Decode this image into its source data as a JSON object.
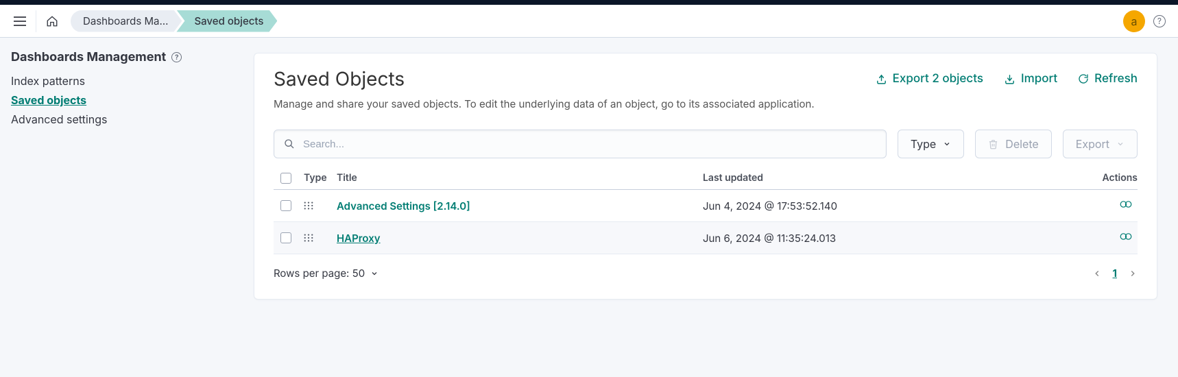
{
  "app_title": "Dashboards Management",
  "breadcrumbs": [
    {
      "label": "Dashboards Ma…"
    },
    {
      "label": "Saved objects",
      "active": true
    }
  ],
  "avatar_letter": "a",
  "sidebar": {
    "title": "Dashboards Management",
    "items": [
      {
        "label": "Index patterns"
      },
      {
        "label": "Saved objects",
        "active": true
      },
      {
        "label": "Advanced settings"
      }
    ]
  },
  "page": {
    "title": "Saved Objects",
    "subtitle": "Manage and share your saved objects. To edit the underlying data of an object, go to its associated application.",
    "actions": {
      "export": "Export 2 objects",
      "import": "Import",
      "refresh": "Refresh"
    }
  },
  "toolbar": {
    "search_placeholder": "Search...",
    "type_label": "Type",
    "delete_label": "Delete",
    "export_label": "Export"
  },
  "table": {
    "headers": {
      "type": "Type",
      "title": "Title",
      "lastUpdated": "Last updated",
      "actions": "Actions"
    },
    "rows": [
      {
        "title": "Advanced Settings [2.14.0]",
        "lastUpdated": "Jun 4, 2024 @ 17:53:52.140"
      },
      {
        "title": "HAProxy",
        "lastUpdated": "Jun 6, 2024 @ 11:35:24.013"
      }
    ]
  },
  "footer": {
    "rows_per_page": "Rows per page: 50",
    "current_page": "1"
  }
}
